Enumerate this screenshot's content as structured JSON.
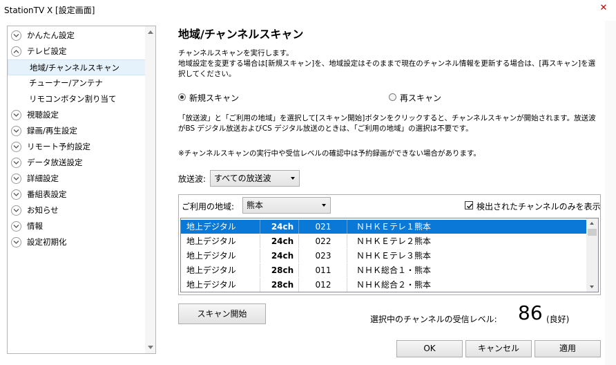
{
  "window": {
    "title": "StationTV X [設定画面]"
  },
  "sidebar": {
    "items": [
      {
        "label": "かんたん設定",
        "type": "category",
        "expanded": false
      },
      {
        "label": "テレビ設定",
        "type": "category",
        "expanded": true
      },
      {
        "label": "地域/チャンネルスキャン",
        "type": "sub",
        "selected": true
      },
      {
        "label": "チューナー/アンテナ",
        "type": "sub",
        "selected": false
      },
      {
        "label": "リモコンボタン割り当て",
        "type": "sub",
        "selected": false
      },
      {
        "label": "視聴設定",
        "type": "category",
        "expanded": false
      },
      {
        "label": "録画/再生設定",
        "type": "category",
        "expanded": false
      },
      {
        "label": "リモート予約設定",
        "type": "category",
        "expanded": false
      },
      {
        "label": "データ放送設定",
        "type": "category",
        "expanded": false
      },
      {
        "label": "詳細設定",
        "type": "category",
        "expanded": false
      },
      {
        "label": "番組表設定",
        "type": "category",
        "expanded": false
      },
      {
        "label": "お知らせ",
        "type": "category",
        "expanded": false
      },
      {
        "label": "情報",
        "type": "category",
        "expanded": false
      },
      {
        "label": "設定初期化",
        "type": "category",
        "expanded": false
      }
    ]
  },
  "main": {
    "title": "地域/チャンネルスキャン",
    "description": [
      "チャンネルスキャンを実行します。",
      "地域設定を変更する場合は[新規スキャン]を、地域設定はそのままで現在のチャンネル情報を更新する場合は、[再スキャン]を選択してください。"
    ],
    "radio_new": {
      "label": "新規スキャン",
      "checked": true
    },
    "radio_rescan": {
      "label": "再スキャン",
      "checked": false
    },
    "info": "「放送波」と「ご利用の地域」を選択して[スキャン開始]ボタンをクリックすると、チャンネルスキャンが開始されます。放送波がBS デジタル放送およびCS デジタル放送のときは、「ご利用の地域」の選択は不要です。",
    "note": "※チャンネルスキャンの実行中や受信レベルの確認中は予約録画ができない場合があります。",
    "broadcast": {
      "label": "放送波:",
      "value": "すべての放送波"
    },
    "area": {
      "label": "ご利用の地域:",
      "value": "熊本"
    },
    "only_detected": {
      "label": "検出されたチャンネルのみを表示",
      "checked": true
    },
    "channels": [
      {
        "type": "地上デジタル",
        "ch": "24ch",
        "num": "021",
        "name": "ＮＨＫＥテレ１熊本",
        "selected": true
      },
      {
        "type": "地上デジタル",
        "ch": "24ch",
        "num": "022",
        "name": "ＮＨＫＥテレ２熊本",
        "selected": false
      },
      {
        "type": "地上デジタル",
        "ch": "24ch",
        "num": "023",
        "name": "ＮＨＫＥテレ３熊本",
        "selected": false
      },
      {
        "type": "地上デジタル",
        "ch": "28ch",
        "num": "011",
        "name": "ＮＨＫ総合１・熊本",
        "selected": false
      },
      {
        "type": "地上デジタル",
        "ch": "28ch",
        "num": "012",
        "name": "ＮＨＫ総合２・熊本",
        "selected": false
      }
    ],
    "scan_button": "スキャン開始",
    "level": {
      "label": "選択中のチャンネルの受信レベル:",
      "value": "86",
      "quality": "(良好)"
    },
    "buttons": {
      "ok": "OK",
      "cancel": "キャンセル",
      "apply": "適用"
    }
  },
  "colors": {
    "selection": "#0a78d7",
    "selected_nav_bg": "#e6f2fb",
    "close_icon": "#c00000"
  }
}
